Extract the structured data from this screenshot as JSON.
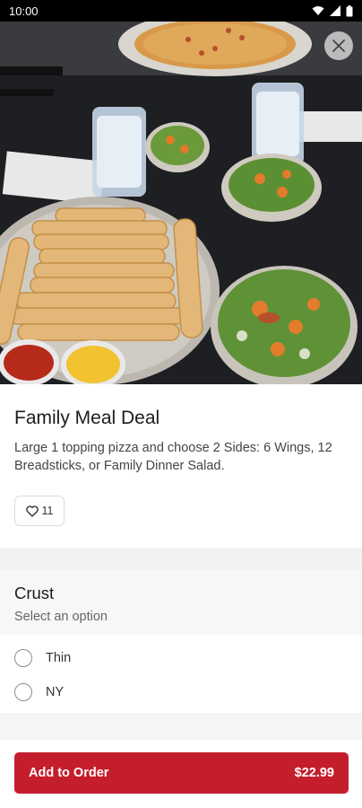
{
  "status_bar": {
    "time": "10:00",
    "icons": [
      "wifi-icon",
      "cell-signal-icon",
      "battery-icon"
    ]
  },
  "hero": {
    "image_desc_icon": "food-photo",
    "close_icon": "close-icon"
  },
  "item": {
    "title": "Family Meal Deal",
    "description": "Large 1 topping pizza and choose 2 Sides:  6 Wings, 12 Breadsticks, or Family Dinner Salad.",
    "likes": "11"
  },
  "crust": {
    "title": "Crust",
    "subtitle": "Select an option",
    "options": [
      {
        "label": "Thin"
      },
      {
        "label": "NY"
      }
    ]
  },
  "footer": {
    "add_label": "Add to Order",
    "price": "$22.99"
  },
  "colors": {
    "accent": "#c41e2d",
    "section_bg": "#f2f2f2"
  }
}
